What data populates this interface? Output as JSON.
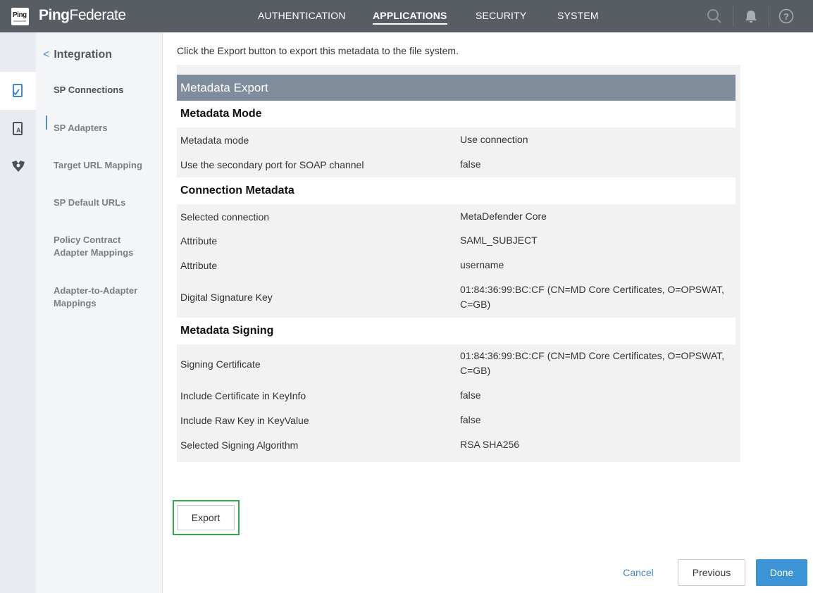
{
  "header": {
    "logo_text": "Ping",
    "brand_bold": "Ping",
    "brand_rest": "Federate",
    "nav": [
      {
        "label": "AUTHENTICATION"
      },
      {
        "label": "APPLICATIONS"
      },
      {
        "label": "SECURITY"
      },
      {
        "label": "SYSTEM"
      }
    ],
    "icons": [
      "search-icon",
      "bell-icon",
      "help-icon"
    ]
  },
  "rail": {
    "icons": [
      "sp-connections-icon",
      "sp-adapters-icon",
      "target-mapping-icon"
    ]
  },
  "sidebar": {
    "back_label": "Integration",
    "items": [
      {
        "label": "SP Connections"
      },
      {
        "label": "SP Adapters"
      },
      {
        "label": "Target URL Mapping"
      },
      {
        "label": "SP Default URLs"
      },
      {
        "label": "Policy Contract Adapter Mappings"
      },
      {
        "label": "Adapter-to-Adapter Mappings"
      }
    ]
  },
  "main": {
    "intro": "Click the Export button to export this metadata to the file system.",
    "panel_title": "Metadata Export",
    "sections": [
      {
        "title": "Metadata Mode",
        "rows": [
          {
            "label": "Metadata mode",
            "value": "Use connection"
          },
          {
            "label": "Use the secondary port for SOAP channel",
            "value": "false"
          }
        ]
      },
      {
        "title": "Connection Metadata",
        "rows": [
          {
            "label": "Selected connection",
            "value": "MetaDefender Core"
          },
          {
            "label": "Attribute",
            "value": "SAML_SUBJECT"
          },
          {
            "label": "Attribute",
            "value": "username"
          },
          {
            "label": "Digital Signature Key",
            "value": "01:84:36:99:BC:CF (CN=MD Core Certificates, O=OPSWAT, C=GB)"
          }
        ]
      },
      {
        "title": "Metadata Signing",
        "rows": [
          {
            "label": "Signing Certificate",
            "value": "01:84:36:99:BC:CF (CN=MD Core Certificates, O=OPSWAT, C=GB)"
          },
          {
            "label": "Include Certificate in KeyInfo",
            "value": "false"
          },
          {
            "label": "Include Raw Key in KeyValue",
            "value": "false"
          },
          {
            "label": "Selected Signing Algorithm",
            "value": "RSA SHA256"
          }
        ]
      }
    ],
    "export_label": "Export"
  },
  "footer": {
    "cancel": "Cancel",
    "previous": "Previous",
    "done": "Done"
  },
  "colors": {
    "topbar": "#575d63",
    "panel_header": "#7e8c9b",
    "primary": "#3b94d6",
    "highlight": "#2eaa4a"
  }
}
